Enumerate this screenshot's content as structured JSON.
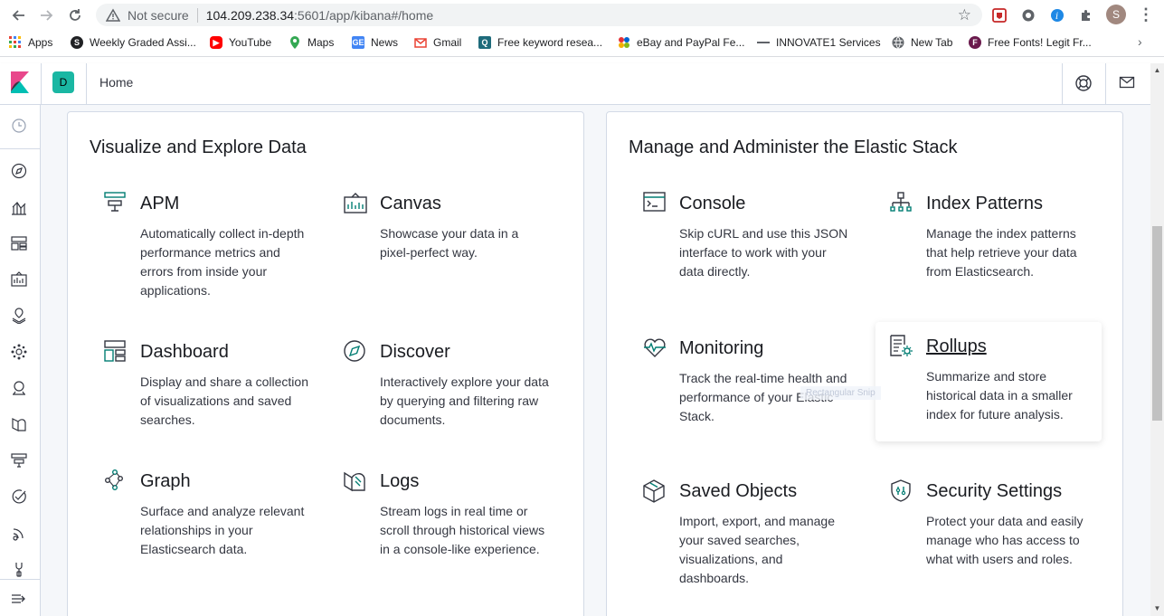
{
  "browser": {
    "secure_label": "Not secure",
    "url_host": "104.209.238.34",
    "url_path": ":5601/app/kibana#/home",
    "profile_initial": "S",
    "bookmarks": [
      {
        "label": "Apps",
        "icon": "apps-grid-icon",
        "color": "#4285f4"
      },
      {
        "label": "Weekly Graded Assi...",
        "icon": "s-logo-icon",
        "color": "#202124"
      },
      {
        "label": "YouTube",
        "icon": "youtube-icon",
        "color": "#ff0000"
      },
      {
        "label": "Maps",
        "icon": "maps-pin-icon",
        "color": "#34a853"
      },
      {
        "label": "News",
        "icon": "google-news-icon",
        "color": "#4285f4"
      },
      {
        "label": "Gmail",
        "icon": "gmail-icon",
        "color": "#ea4335"
      },
      {
        "label": "Free keyword resea...",
        "icon": "keyword-tool-icon",
        "color": "#1e6b7b"
      },
      {
        "label": "eBay and PayPal Fe...",
        "icon": "ebay-paypal-icon",
        "color": "#e53238"
      },
      {
        "label": "INNOVATE1 Services",
        "icon": "innovate-icon",
        "color": "#5f6368"
      },
      {
        "label": "New Tab",
        "icon": "globe-icon",
        "color": "#5f6368"
      },
      {
        "label": "Free Fonts! Legit Fr...",
        "icon": "fonts-icon",
        "color": "#6a1b4d"
      }
    ]
  },
  "kibana": {
    "space_initial": "D",
    "breadcrumb": "Home",
    "left_panel": {
      "title": "Visualize and Explore Data",
      "features": [
        {
          "title": "APM",
          "icon": "apm-icon",
          "desc": "Automatically collect in-depth performance metrics and errors from inside your applications."
        },
        {
          "title": "Canvas",
          "icon": "canvas-icon",
          "desc": "Showcase your data in a pixel-perfect way."
        },
        {
          "title": "Dashboard",
          "icon": "dashboard-icon",
          "desc": "Display and share a collection of visualizations and saved searches."
        },
        {
          "title": "Discover",
          "icon": "discover-compass-icon",
          "desc": "Interactively explore your data by querying and filtering raw documents."
        },
        {
          "title": "Graph",
          "icon": "graph-icon",
          "desc": "Surface and analyze relevant relationships in your Elasticsearch data."
        },
        {
          "title": "Logs",
          "icon": "logs-icon",
          "desc": "Stream logs in real time or scroll through historical views in a console-like experience."
        }
      ]
    },
    "right_panel": {
      "title": "Manage and Administer the Elastic Stack",
      "features": [
        {
          "title": "Console",
          "icon": "console-icon",
          "desc": "Skip cURL and use this JSON interface to work with your data directly."
        },
        {
          "title": "Index Patterns",
          "icon": "index-patterns-icon",
          "desc": "Manage the index patterns that help retrieve your data from Elasticsearch."
        },
        {
          "title": "Monitoring",
          "icon": "monitoring-icon",
          "desc": "Track the real-time health and performance of your Elastic Stack."
        },
        {
          "title": "Rollups",
          "icon": "rollups-icon",
          "desc": "Summarize and store historical data in a smaller index for future analysis."
        },
        {
          "title": "Saved Objects",
          "icon": "saved-objects-icon",
          "desc": "Import, export, and manage your saved searches, visualizations, and dashboards."
        },
        {
          "title": "Security Settings",
          "icon": "security-shield-icon",
          "desc": "Protect your data and easily manage who has access to what with users and roles."
        }
      ]
    },
    "snip_tooltip": "Rectangular Snip",
    "colors": {
      "accent": "#017d73",
      "brand_teal": "#1ab7a3",
      "text": "#343741"
    }
  }
}
